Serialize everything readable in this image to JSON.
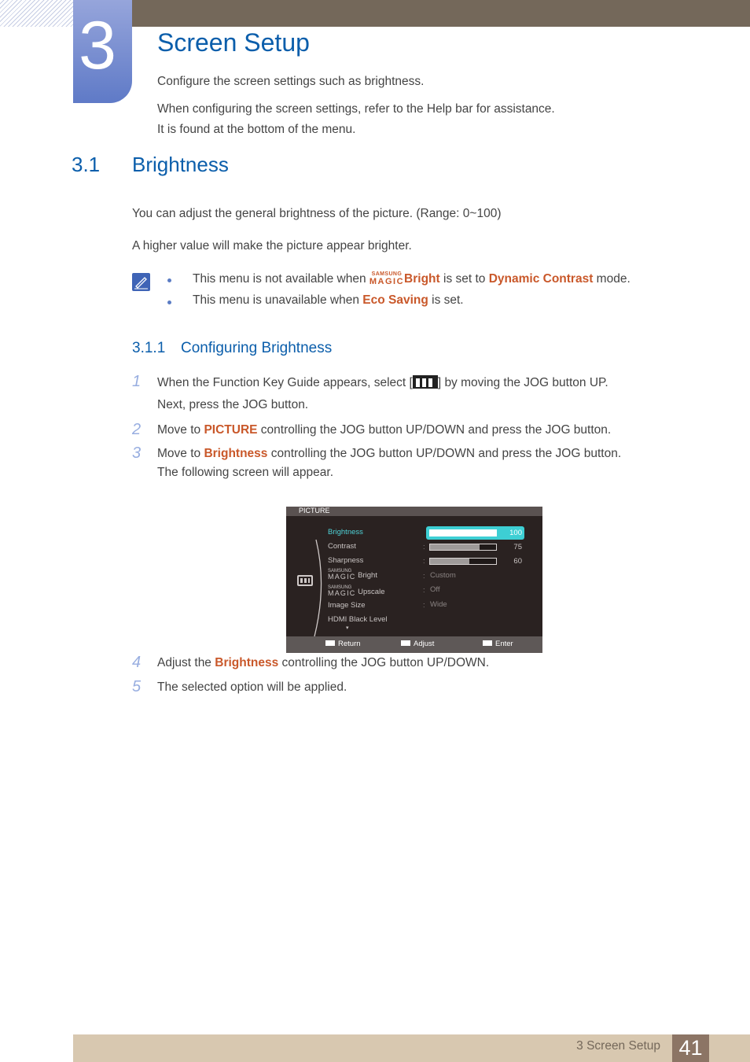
{
  "chapter": {
    "number": "3",
    "title": "Screen Setup",
    "intro": "Configure the screen settings such as brightness.",
    "help_line1": "When configuring the screen settings, refer to the Help bar for assistance.",
    "help_line2": "It is found at the bottom of the menu."
  },
  "section": {
    "number": "3.1",
    "title": "Brightness",
    "para1": "You can adjust the general brightness of the picture. (Range: 0~100)",
    "para2": "A higher value will make the picture appear brighter.",
    "notes": [
      {
        "pre": "This menu is not available when ",
        "magic_small": "SAMSUNG",
        "magic_big": "MAGIC",
        "hl1": "Bright",
        "mid": " is set to ",
        "hl2": "Dynamic Contrast",
        "post": " mode."
      },
      {
        "pre": "This menu is unavailable when ",
        "hl1": "Eco Saving",
        "post": " is set."
      }
    ]
  },
  "subsection": {
    "number": "3.1.1",
    "title": "Configuring Brightness",
    "steps": [
      {
        "num": "1",
        "pre": "When the Function Key Guide appears, select [",
        "post": "] by moving the JOG button UP.",
        "line2": "Next, press the JOG button."
      },
      {
        "num": "2",
        "pre": "Move to ",
        "hl": "PICTURE",
        "post": " controlling the JOG button UP/DOWN and press the JOG button."
      },
      {
        "num": "3",
        "pre": "Move to ",
        "hl": "Brightness",
        "post": " controlling the JOG button UP/DOWN and press the JOG button.",
        "line2": "The following screen will appear."
      },
      {
        "num": "4",
        "pre": "Adjust the ",
        "hl": "Brightness",
        "post": " controlling the JOG button UP/DOWN."
      },
      {
        "num": "5",
        "pre": "The selected option will be applied."
      }
    ]
  },
  "osd": {
    "header": "PICTURE",
    "items": [
      {
        "label": "Brightness",
        "value": 100,
        "type": "bar",
        "selected": true
      },
      {
        "label": "Contrast",
        "value": 75,
        "type": "bar"
      },
      {
        "label": "Sharpness",
        "value": 60,
        "type": "bar"
      },
      {
        "magic_small": "SAMSUNG",
        "magic_big": "MAGIC",
        "label": "Bright",
        "text_value": "Custom"
      },
      {
        "magic_small": "SAMSUNG",
        "magic_big": "MAGIC",
        "label": "Upscale",
        "text_value": "Off"
      },
      {
        "label": "Image Size",
        "text_value": "Wide"
      },
      {
        "label": "HDMI Black Level"
      }
    ],
    "colon": ":",
    "more_arrow": "▾",
    "footer": {
      "return": "Return",
      "adjust": "Adjust",
      "enter": "Enter"
    }
  },
  "footer": {
    "chapter_label": "3 Screen Setup",
    "page": "41"
  }
}
